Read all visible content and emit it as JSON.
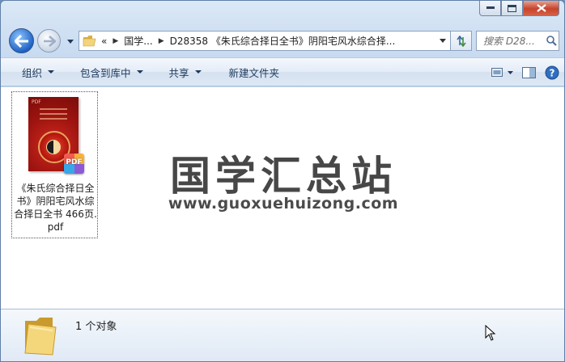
{
  "window": {
    "caption_buttons": [
      "minimize",
      "maximize",
      "close"
    ]
  },
  "address_bar": {
    "overflow_chevron": "«",
    "breadcrumbs": [
      "国学...",
      "D28358 《朱氏综合择日全书》阴阳宅风水综合择..."
    ]
  },
  "search": {
    "placeholder": "搜索 D28..."
  },
  "toolbar": {
    "organize": "组织",
    "include_in_library": "包含到库中",
    "share": "共享",
    "new_folder": "新建文件夹"
  },
  "file": {
    "name": "《朱氏综合择日全书》阴阳宅风水综合择日全书 466页.pdf",
    "badge": "PDF",
    "thumb_label": "PDF"
  },
  "watermark": {
    "title": "国学汇总站",
    "url": "www.guoxuehuizong.com"
  },
  "details": {
    "count": "1 个对象"
  },
  "colors": {
    "window_frame": "#c7daf0",
    "toolbar_text": "#1e395b",
    "close_button": "#c7432b",
    "thumb_red": "#9e1410"
  }
}
